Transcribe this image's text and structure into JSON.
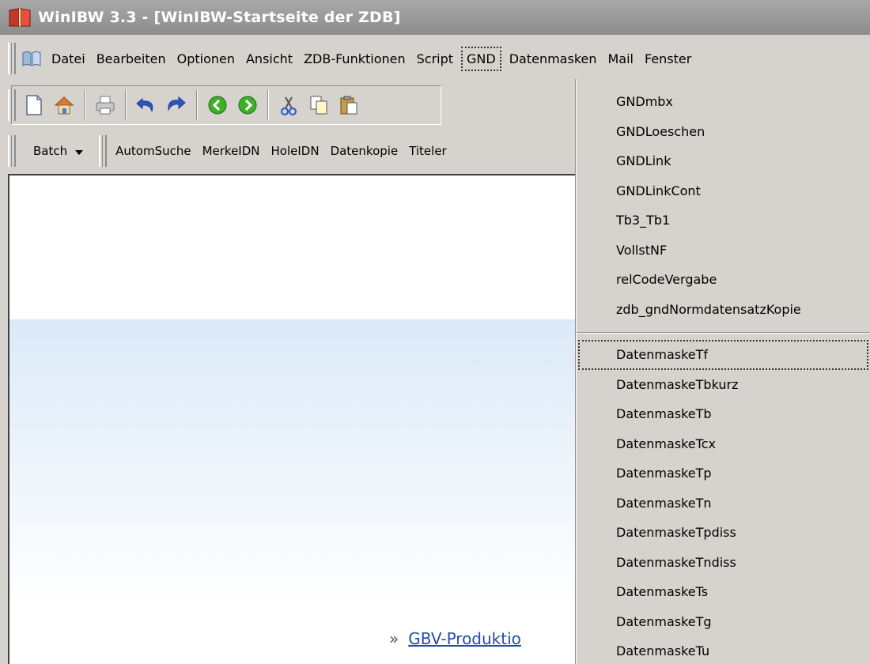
{
  "window": {
    "title": "WinIBW 3.3 - [WinIBW-Startseite der ZDB]"
  },
  "menubar": {
    "items": [
      {
        "label": "Datei"
      },
      {
        "label": "Bearbeiten"
      },
      {
        "label": "Optionen"
      },
      {
        "label": "Ansicht"
      },
      {
        "label": "ZDB-Funktionen"
      },
      {
        "label": "Script"
      },
      {
        "label": "GND",
        "active": true
      },
      {
        "label": "Datenmasken"
      },
      {
        "label": "Mail"
      },
      {
        "label": "Fenster"
      }
    ]
  },
  "toolbar_icons": [
    "new-document-icon",
    "home-icon",
    "print-icon",
    "undo-icon",
    "redo-icon",
    "back-icon",
    "forward-icon",
    "cut-icon",
    "copy-icon",
    "paste-icon"
  ],
  "toolbar2": {
    "batch_label": "Batch",
    "items": [
      {
        "label": "AutomSuche"
      },
      {
        "label": "MerkeIDN"
      },
      {
        "label": "HoleIDN"
      },
      {
        "label": "Datenkopie"
      },
      {
        "label": "Titeler"
      }
    ]
  },
  "content": {
    "link_text": "GBV-Produktio"
  },
  "gnd_menu": {
    "group1": [
      {
        "label": "GNDmbx"
      },
      {
        "label": "GNDLoeschen"
      },
      {
        "label": "GNDLink"
      },
      {
        "label": "GNDLinkCont"
      },
      {
        "label": "Tb3_Tb1"
      },
      {
        "label": "VollstNF"
      },
      {
        "label": "relCodeVergabe"
      },
      {
        "label": "zdb_gndNormdatensatzKopie"
      }
    ],
    "group2": [
      {
        "label": "DatenmaskeTf",
        "focused": true
      },
      {
        "label": "DatenmaskeTbkurz"
      },
      {
        "label": "DatenmaskeTb"
      },
      {
        "label": "DatenmaskeTcx"
      },
      {
        "label": "DatenmaskeTp"
      },
      {
        "label": "DatenmaskeTn"
      },
      {
        "label": "DatenmaskeTpdiss"
      },
      {
        "label": "DatenmaskeTndiss"
      },
      {
        "label": "DatenmaskeTs"
      },
      {
        "label": "DatenmaskeTg"
      },
      {
        "label": "DatenmaskeTu"
      }
    ]
  }
}
